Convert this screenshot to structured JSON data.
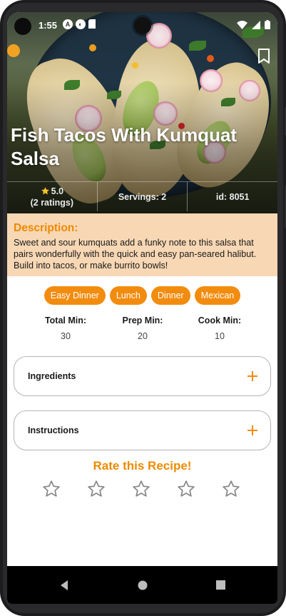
{
  "status_bar": {
    "time": "1:55",
    "icons_left": [
      "accessibility-icon",
      "assistant-icon",
      "sd-card-icon"
    ],
    "icons_right": [
      "wifi-icon",
      "signal-icon",
      "battery-icon"
    ]
  },
  "recipe": {
    "title": "Fish Tacos With Kumquat Salsa",
    "rating_value": "5.0",
    "rating_count": "(2 ratings)",
    "servings": "Servings: 2",
    "id": "id: 8051"
  },
  "description": {
    "label": "Description:",
    "text": "Sweet and sour kumquats add a funky note to this salsa that pairs wonderfully with the quick and easy pan-seared halibut. Build into tacos, or make burrito bowls!"
  },
  "tags": [
    "Easy Dinner",
    "Lunch",
    "Dinner",
    "Mexican"
  ],
  "times": {
    "total_label": "Total Min:",
    "total_value": "30",
    "prep_label": "Prep Min:",
    "prep_value": "20",
    "cook_label": "Cook Min:",
    "cook_value": "10"
  },
  "sections": {
    "ingredients": "Ingredients",
    "instructions": "Instructions"
  },
  "rating_widget": {
    "title": "Rate this Recipe!",
    "stars_selected": 0,
    "stars_total": 5
  },
  "colors": {
    "accent": "#f28c0f",
    "description_bg": "#f7d7b4",
    "star_outline": "#888888"
  }
}
